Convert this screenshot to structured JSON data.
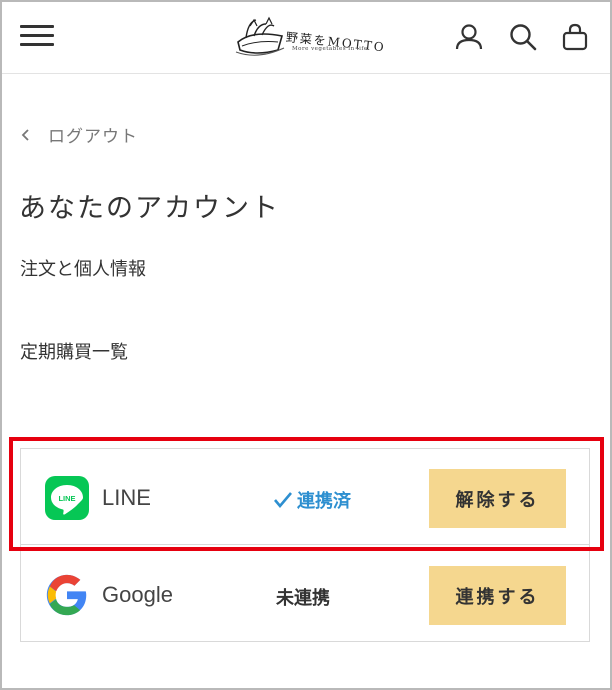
{
  "header": {
    "logo": {
      "title": "野菜をMOTTO",
      "tagline": "More vegetables in life"
    },
    "icons": {
      "menu": "hamburger-menu-icon",
      "account": "account-icon",
      "search": "search-icon",
      "cart": "shopping-bag-icon"
    }
  },
  "back_link": {
    "label": "ログアウト"
  },
  "page_title": "あなたのアカウント",
  "nav": {
    "orders_label": "注文と個人情報",
    "subscriptions_label": "定期購買一覧"
  },
  "connections": [
    {
      "service": "LINE",
      "icon": "line-logo-icon",
      "status": "連携済",
      "status_color": "#2d8fd0",
      "action_label": "解除する"
    },
    {
      "service": "Google",
      "icon": "google-logo-icon",
      "status": "未連携",
      "status_color": "#333333",
      "action_label": "連携する"
    }
  ],
  "colors": {
    "button_bg": "#f5d78f",
    "highlight_border": "#e6000f",
    "line_green": "#06c755"
  }
}
